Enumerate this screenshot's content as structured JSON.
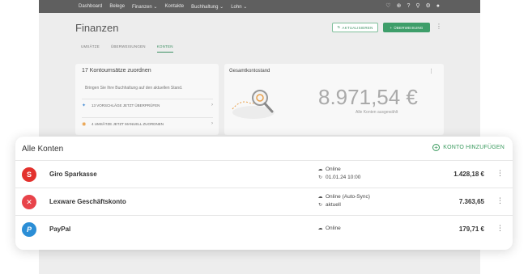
{
  "nav": {
    "items": [
      "Dashboard",
      "Belege",
      "Finanzen ⌄",
      "Kontakte",
      "Buchhaltung ⌄",
      "Lohn ⌄"
    ],
    "icons": [
      "heart-icon",
      "plus-circle-icon",
      "help-icon",
      "search-icon",
      "gear-icon",
      "user-icon"
    ]
  },
  "page": {
    "title": "Finanzen",
    "refresh_label": "Aktualisieren",
    "transfer_label": "Überweisung"
  },
  "tabs": [
    {
      "label": "Umsätze"
    },
    {
      "label": "Überweisungen"
    },
    {
      "label": "Konten"
    }
  ],
  "card_left": {
    "title": "17 Kontoumsätze zuordnen",
    "desc": "Bringen Sie Ihre Buchhaltung auf den aktuellen Stand.",
    "rows": [
      {
        "label": "13 Vorschläge jetzt überprüfen"
      },
      {
        "label": "4 Umsätze jetzt manuell zuordnen"
      }
    ]
  },
  "card_right": {
    "title": "Gesamtkontostand",
    "balance": "8.971,54 €",
    "subtitle": "Alle Konten ausgewählt"
  },
  "modal": {
    "title": "Alle Konten",
    "add_label": "Konto hinzufügen",
    "accounts": [
      {
        "name": "Giro Sparkasse",
        "status": "Online",
        "detail": "01.01.24 10:00",
        "amount": "1.428,18 €",
        "icon": "sparkasse-icon",
        "color": "#e3312d"
      },
      {
        "name": "Lexware Geschäftskonto",
        "status": "Online (Auto-Sync)",
        "detail": "aktuell",
        "amount": "7.363,65",
        "icon": "lexware-icon",
        "color": "#e8434a"
      },
      {
        "name": "PayPal",
        "status": "Online",
        "amount": "179,71 €",
        "icon": "paypal-icon",
        "color": "#2b8ed6"
      }
    ]
  },
  "colors": {
    "accent": "#3a9a5e",
    "nav_bg": "#5f5f5f"
  }
}
